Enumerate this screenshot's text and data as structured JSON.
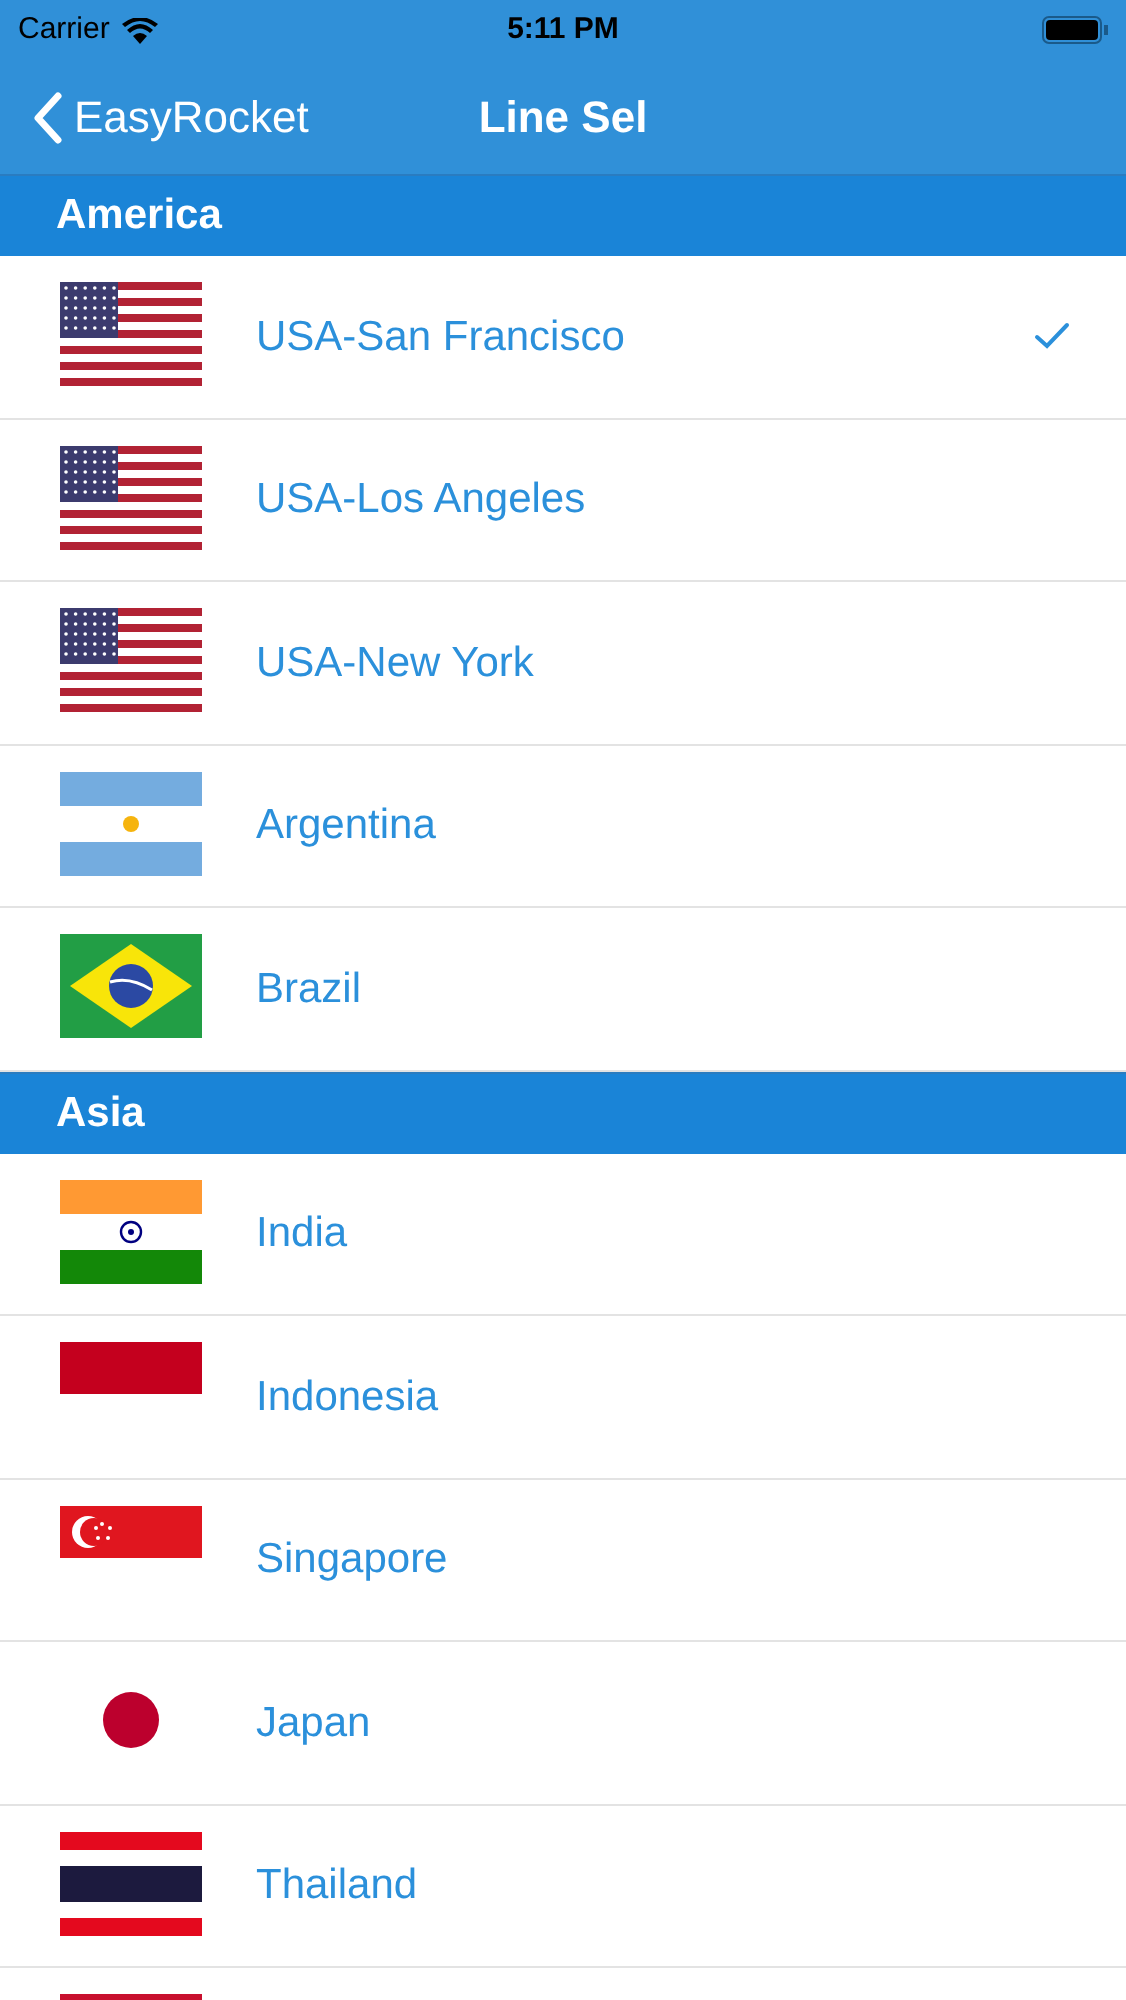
{
  "status_bar": {
    "carrier": "Carrier",
    "time": "5:11 PM"
  },
  "nav": {
    "back": "EasyRocket",
    "title": "Line Sel"
  },
  "sections": [
    {
      "title": "America",
      "rows": [
        {
          "name": "USA-San Francisco",
          "kind": "usa",
          "selected": true
        },
        {
          "name": "USA-Los Angeles",
          "kind": "usa",
          "selected": false
        },
        {
          "name": "USA-New York",
          "kind": "usa",
          "selected": false
        },
        {
          "name": "Argentina",
          "kind": "argentina",
          "selected": false
        },
        {
          "name": "Brazil",
          "kind": "brazil",
          "selected": false
        }
      ]
    },
    {
      "title": "Asia",
      "rows": [
        {
          "name": "India",
          "kind": "india",
          "selected": false
        },
        {
          "name": "Indonesia",
          "kind": "indonesia",
          "selected": false
        },
        {
          "name": "Singapore",
          "kind": "singapore",
          "selected": false
        },
        {
          "name": "Japan",
          "kind": "japan",
          "selected": false
        },
        {
          "name": "Thailand",
          "kind": "thailand",
          "selected": false
        },
        {
          "kind": "red-band"
        }
      ]
    }
  ]
}
